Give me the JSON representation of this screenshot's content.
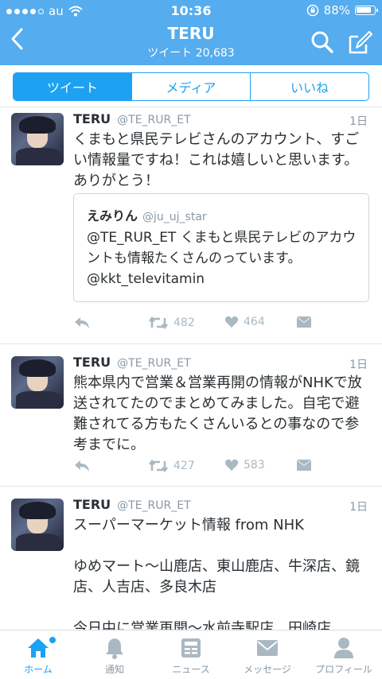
{
  "status_bar": {
    "carrier": "au",
    "time": "10:36",
    "battery": "88%",
    "battery_level": 0.88
  },
  "nav": {
    "title": "TERU",
    "subtitle": "ツイート 20,683"
  },
  "segments": {
    "tweets": "ツイート",
    "media": "メディア",
    "likes": "いいね"
  },
  "tweets": [
    {
      "name": "TERU",
      "handle": "@TE_RUR_ET",
      "time": "1日",
      "text": "くまもと県民テレビさんのアカウント、すごい情報量ですね！これは嬉しいと思います。ありがとう！",
      "quote": {
        "name": "えみりん",
        "handle": "@ju_uj_star",
        "text": "@TE_RUR_ET くまもと県民テレビのアカウントも情報たくさんのっています。@kkt_televitamin"
      },
      "retweets": "482",
      "likes": "464"
    },
    {
      "name": "TERU",
      "handle": "@TE_RUR_ET",
      "time": "1日",
      "text": "熊本県内で営業＆営業再開の情報がNHKで放送されてたのでまとめてみました。自宅で避難されてる方もたくさんいるとの事なので参考までに。",
      "retweets": "427",
      "likes": "583"
    },
    {
      "name": "TERU",
      "handle": "@TE_RUR_ET",
      "time": "1日",
      "text": "スーパーマーケット情報 from NHK\n\nゆめマート〜山鹿店、東山鹿店、牛深店、鏡店、人吉店、多良木店\n\n今日中に営業再開〜水前寺駅店、田崎店"
    }
  ],
  "tabbar": {
    "home": "ホーム",
    "notifications": "通知",
    "news": "ニュース",
    "messages": "メッセージ",
    "profile": "プロフィール"
  },
  "icons": {
    "back": "chevron-left-icon",
    "search": "search-icon",
    "compose": "compose-icon",
    "reply": "reply-icon",
    "retweet": "retweet-icon",
    "like": "heart-icon",
    "dm": "envelope-icon"
  },
  "colors": {
    "brand": "#55acee",
    "accent": "#1da1f2",
    "muted": "#8899a6"
  }
}
